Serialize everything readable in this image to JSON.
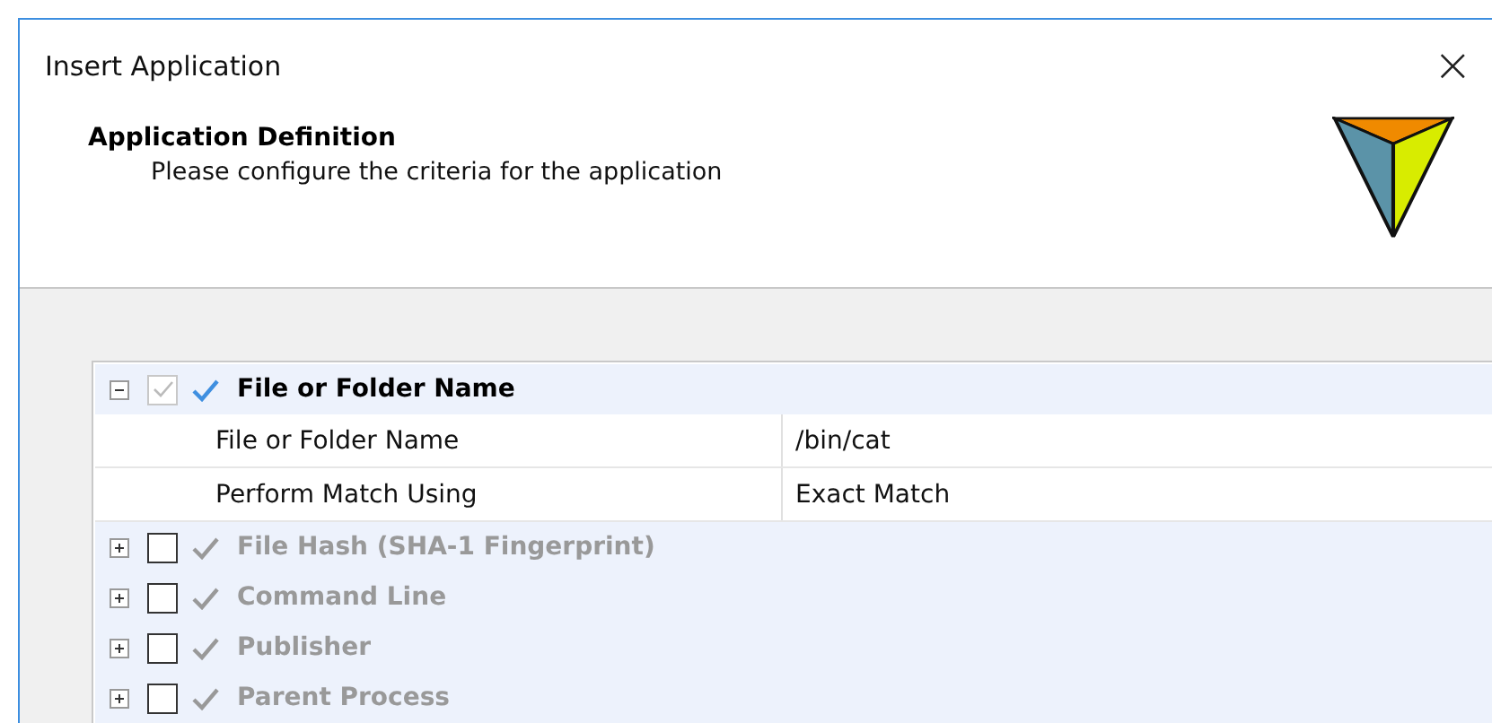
{
  "window": {
    "title": "Insert Application",
    "close": "×"
  },
  "header": {
    "title": "Application Definition",
    "subtitle": "Please configure the criteria for the application"
  },
  "criteria": [
    {
      "name": "File or Folder Name",
      "expanded": true,
      "checked": true,
      "enabled": true,
      "properties": [
        {
          "label": "File or Folder Name",
          "value": "/bin/cat"
        },
        {
          "label": "Perform Match Using",
          "value": "Exact Match"
        }
      ]
    },
    {
      "name": "File Hash (SHA-1 Fingerprint)",
      "expanded": false,
      "checked": false,
      "enabled": false
    },
    {
      "name": "Command Line",
      "expanded": false,
      "checked": false,
      "enabled": false
    },
    {
      "name": "Publisher",
      "expanded": false,
      "checked": false,
      "enabled": false
    },
    {
      "name": "Parent Process",
      "expanded": false,
      "checked": false,
      "enabled": false
    }
  ]
}
